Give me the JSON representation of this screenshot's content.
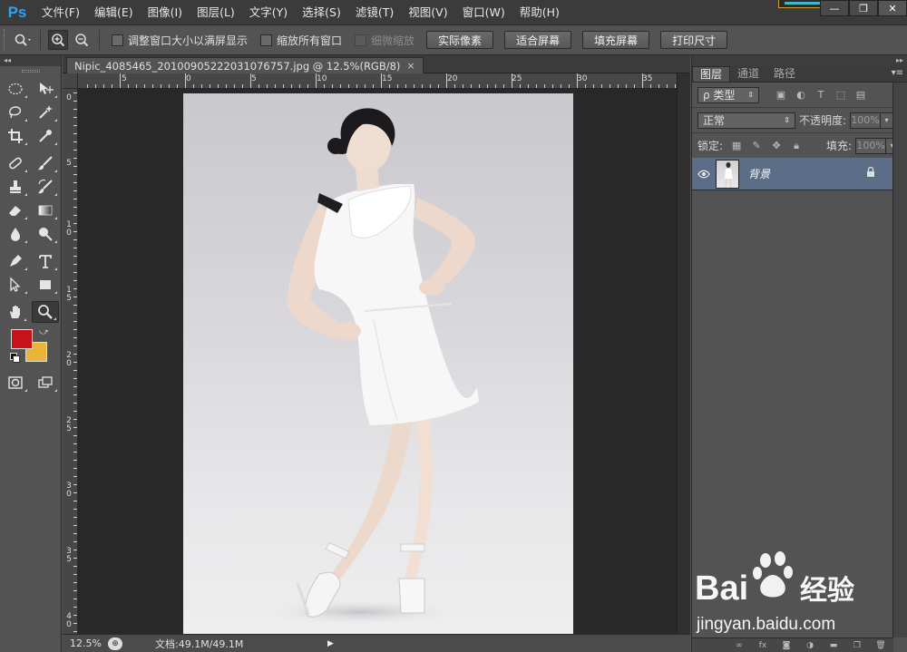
{
  "app": {
    "logo": "Ps",
    "menu": [
      "文件(F)",
      "编辑(E)",
      "图像(I)",
      "图层(L)",
      "文字(Y)",
      "选择(S)",
      "滤镜(T)",
      "视图(V)",
      "窗口(W)",
      "帮助(H)"
    ],
    "window_controls": {
      "minimize": "—",
      "restore": "❐",
      "close": "✕"
    }
  },
  "options_bar": {
    "resize_windows_label": "调整窗口大小以满屏显示",
    "zoom_all_label": "缩放所有窗口",
    "scrubby_zoom_label": "细微缩放",
    "buttons": [
      "实际像素",
      "适合屏幕",
      "填充屏幕",
      "打印尺寸"
    ]
  },
  "toolbar": {
    "collapse_glyph": "◂◂",
    "foreground_color": "#c8121b",
    "background_color": "#e8b53a",
    "swap_glyph": "⤻"
  },
  "document": {
    "tab_title": "Nipic_4085465_20100905222031076757.jpg @ 12.5%(RGB/8)",
    "tab_close": "×",
    "ruler_h": [
      "5",
      "0",
      "5",
      "10",
      "15",
      "20",
      "25",
      "30",
      "35"
    ],
    "ruler_v": [
      [
        "0"
      ],
      [
        "5"
      ],
      [
        "1",
        "0"
      ],
      [
        "1",
        "5"
      ],
      [
        "2",
        "0"
      ],
      [
        "2",
        "5"
      ],
      [
        "3",
        "0"
      ],
      [
        "3",
        "5"
      ],
      [
        "4",
        "0"
      ]
    ],
    "status_zoom": "12.5%",
    "status_doc": "文档:49.1M/49.1M",
    "status_arrow": "▶"
  },
  "panels": {
    "collapse_glyph": "▸▸",
    "tabs": [
      "图层",
      "通道",
      "路径"
    ],
    "menu_glyph": "▾≡",
    "filter_kind": "ρ 类型",
    "blend_mode": "正常",
    "opacity_label": "不透明度:",
    "opacity_value": "100%",
    "lock_label": "锁定:",
    "fill_label": "填充:",
    "fill_value": "100%",
    "layers": [
      {
        "name": "背景",
        "visible": true,
        "locked": true
      }
    ],
    "bottom_icons": [
      "link-icon",
      "fx-icon",
      "mask-icon",
      "adjustment-icon",
      "group-icon",
      "new-layer-icon",
      "trash-icon"
    ],
    "fx_text": "fx"
  },
  "watermark": {
    "brand": "Bai",
    "brand_cn": "经验",
    "url": "jingyan.baidu.com"
  }
}
